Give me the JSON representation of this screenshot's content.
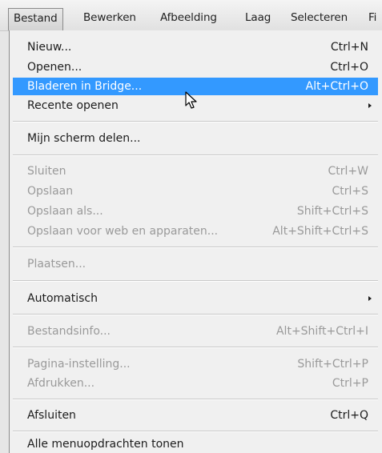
{
  "menubar": {
    "items": [
      {
        "label": "Bestand"
      },
      {
        "label": "Bewerken"
      },
      {
        "label": "Afbeelding"
      },
      {
        "label": "Laag"
      },
      {
        "label": "Selecteren"
      },
      {
        "label": "Fi"
      }
    ]
  },
  "menu": {
    "items": [
      {
        "label": "Nieuw...",
        "shortcut": "Ctrl+N"
      },
      {
        "label": "Openen...",
        "shortcut": "Ctrl+O"
      },
      {
        "label": "Bladeren in Bridge...",
        "shortcut": "Alt+Ctrl+O"
      },
      {
        "label": "Recente openen",
        "shortcut": ""
      },
      {
        "label": "Mijn scherm delen...",
        "shortcut": ""
      },
      {
        "label": "Sluiten",
        "shortcut": "Ctrl+W"
      },
      {
        "label": "Opslaan",
        "shortcut": "Ctrl+S"
      },
      {
        "label": "Opslaan als...",
        "shortcut": "Shift+Ctrl+S"
      },
      {
        "label": "Opslaan voor web en apparaten...",
        "shortcut": "Alt+Shift+Ctrl+S"
      },
      {
        "label": "Plaatsen...",
        "shortcut": ""
      },
      {
        "label": "Automatisch",
        "shortcut": ""
      },
      {
        "label": "Bestandsinfo...",
        "shortcut": "Alt+Shift+Ctrl+I"
      },
      {
        "label": "Pagina-instelling...",
        "shortcut": "Shift+Ctrl+P"
      },
      {
        "label": "Afdrukken...",
        "shortcut": "Ctrl+P"
      },
      {
        "label": "Afsluiten",
        "shortcut": "Ctrl+Q"
      },
      {
        "label": "Alle menuopdrachten tonen",
        "shortcut": ""
      }
    ]
  },
  "icons": {
    "cursor": "mouse-pointer-icon",
    "submenu_arrow": "chevron-right-icon"
  },
  "colors": {
    "highlight": "#3399ff",
    "disabled_text": "#9a9a9a",
    "menu_background": "#f0f0f0"
  }
}
